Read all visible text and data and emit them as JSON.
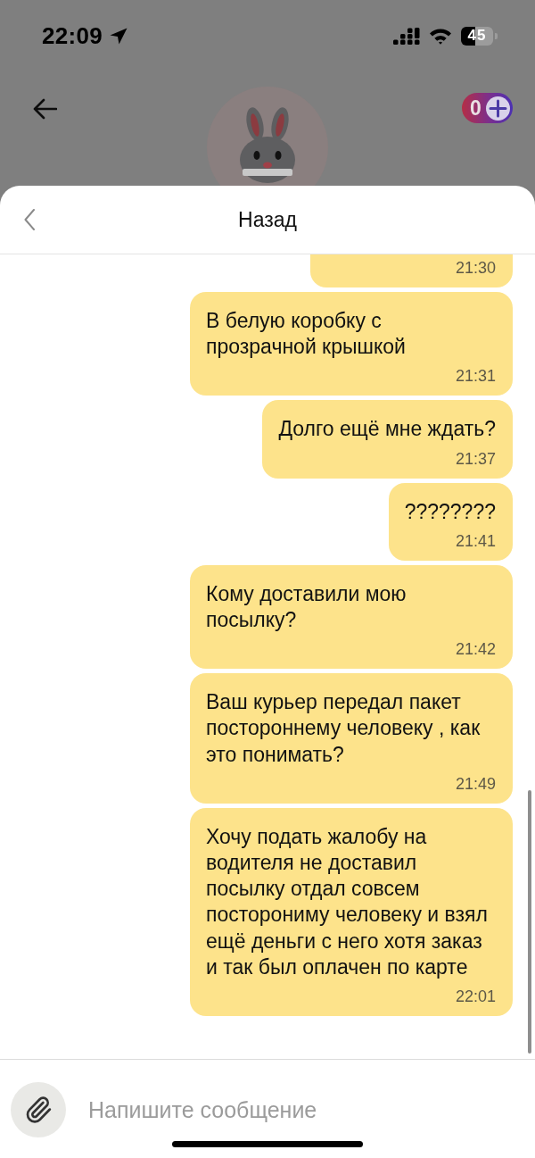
{
  "status_bar": {
    "time": "22:09",
    "battery": "45"
  },
  "header": {
    "points": "0"
  },
  "sheet": {
    "title": "Назад"
  },
  "messages": [
    {
      "time": "21:30"
    },
    {
      "text": "В белую коробку с прозрачной крышкой",
      "time": "21:31"
    },
    {
      "text": "Долго ещё мне ждать?",
      "time": "21:37"
    },
    {
      "text": "????????",
      "time": "21:41"
    },
    {
      "text": "Кому доставили мою посылку?",
      "time": "21:42"
    },
    {
      "text": "Ваш курьер передал пакет постороннему человеку , как это понимать?",
      "time": "21:49"
    },
    {
      "text": "Хочу подать жалобу на водителя не доставил посылку отдал совсем посторониму человеку и взял ещё деньги с него хотя заказ и так был оплачен по карте",
      "time": "22:01"
    }
  ],
  "composer": {
    "placeholder": "Напишите сообщение"
  }
}
